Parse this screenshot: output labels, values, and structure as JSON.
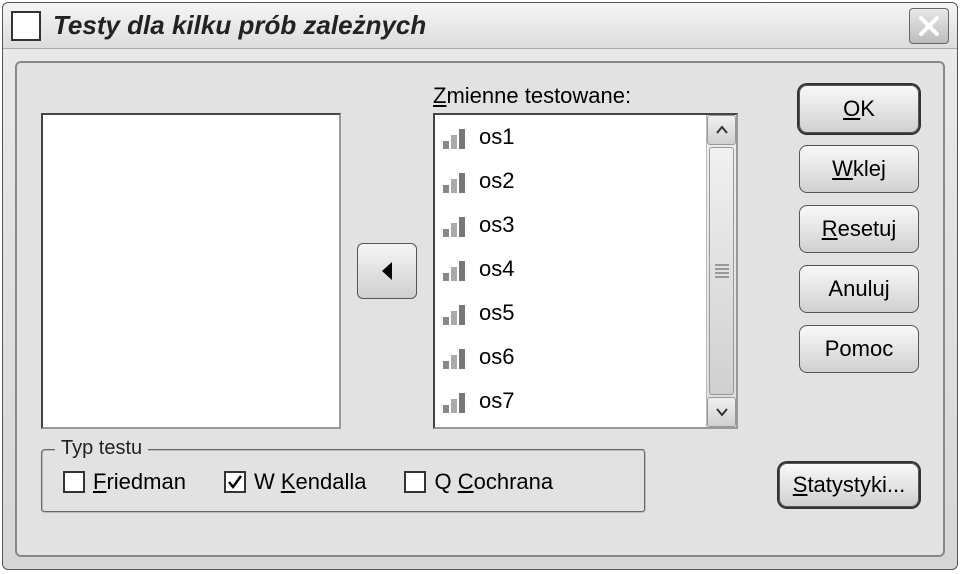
{
  "title": "Testy dla kilku prób zależnych",
  "dest_label_prefix": "Z",
  "dest_label_rest": "mienne testowane:",
  "variables": [
    "os1",
    "os2",
    "os3",
    "os4",
    "os5",
    "os6",
    "os7"
  ],
  "buttons": {
    "ok_ul": "O",
    "ok_rest": "K",
    "paste_ul": "W",
    "paste_rest": "klej",
    "reset_ul": "R",
    "reset_rest": "esetuj",
    "cancel": "Anuluj",
    "help": "Pomoc",
    "stats_ul": "S",
    "stats_rest": "tatystyki..."
  },
  "fieldset": {
    "legend": "Typ testu",
    "options": [
      {
        "ul": "F",
        "rest": "riedman",
        "checked": false
      },
      {
        "prefix": "W ",
        "ul": "K",
        "rest": "endalla",
        "checked": true
      },
      {
        "prefix": "Q ",
        "ul": "C",
        "rest": "ochrana",
        "checked": false
      }
    ]
  }
}
